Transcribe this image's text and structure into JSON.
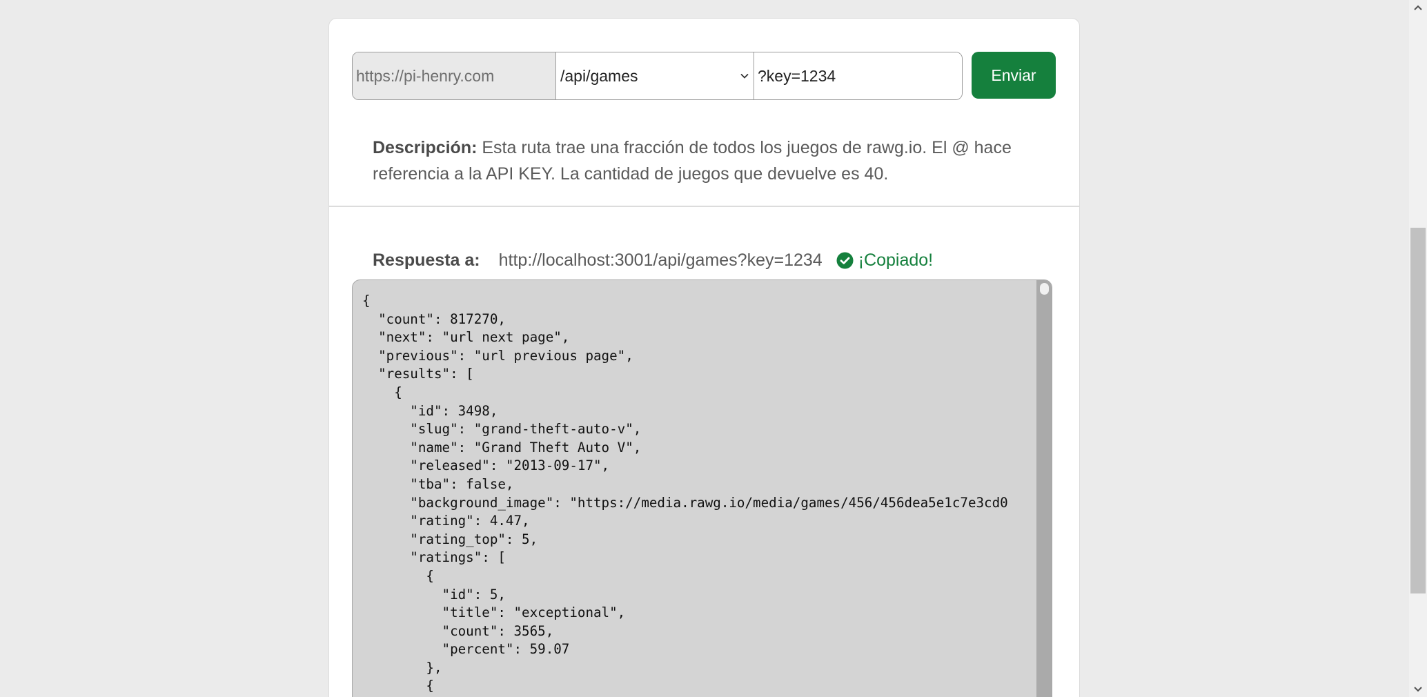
{
  "request": {
    "base_url": "https://pi-henry.com",
    "route_selected": "/api/games",
    "query_value": "?key=1234",
    "send_label": "Enviar"
  },
  "description": {
    "label": "Descripción:",
    "text": " Esta ruta trae una fracción de todos los juegos de rawg.io. El @ hace referencia a la API KEY. La cantidad de juegos que devuelve es 40."
  },
  "response": {
    "label": "Respuesta a:",
    "url": "http://localhost:3001/api/games?key=1234",
    "copied_text": "¡Copiado!"
  },
  "code_lines": [
    "{",
    "  \"count\": 817270,",
    "  \"next\": \"url next page\",",
    "  \"previous\": \"url previous page\",",
    "  \"results\": [",
    "    {",
    "      \"id\": 3498,",
    "      \"slug\": \"grand-theft-auto-v\",",
    "      \"name\": \"Grand Theft Auto V\",",
    "      \"released\": \"2013-09-17\",",
    "      \"tba\": false,",
    "      \"background_image\": \"https://media.rawg.io/media/games/456/456dea5e1c7e3cd0",
    "      \"rating\": 4.47,",
    "      \"rating_top\": 5,",
    "      \"ratings\": [",
    "        {",
    "          \"id\": 5,",
    "          \"title\": \"exceptional\",",
    "          \"count\": 3565,",
    "          \"percent\": 59.07",
    "        },",
    "        {"
  ],
  "colors": {
    "accent_green": "#15803d",
    "page_bg": "#ebebeb",
    "code_bg": "#d4d4d4"
  },
  "icons": {
    "dropdown": "chevron-down-icon",
    "copied": "check-circle-icon"
  }
}
